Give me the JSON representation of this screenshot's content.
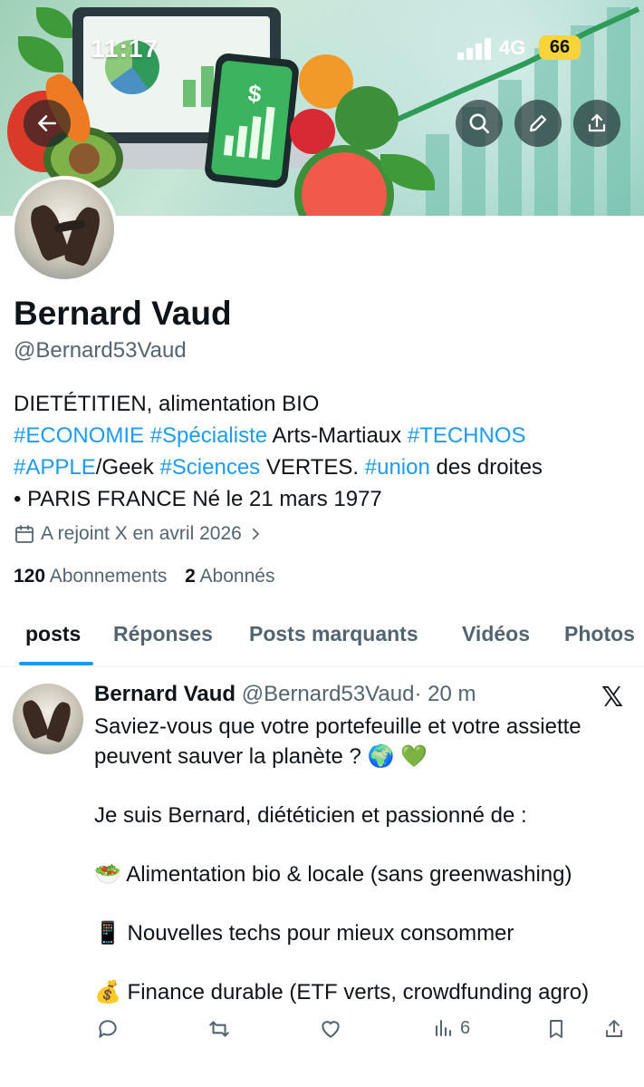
{
  "status_bar": {
    "time": "11:17",
    "network": "4G",
    "battery": "66"
  },
  "profile": {
    "name": "Bernard Vaud",
    "handle": "@Bernard53Vaud",
    "bio": {
      "line1": "DIETÉTITIEN, alimentation BIO",
      "l2_tag1": "#ECONOMIE",
      "l2_tag2": "#Spécialiste",
      "l2_text": " Arts-Martiaux ",
      "l2_tag3": "#TECHNOS",
      "l3_tag1": "#APPLE",
      "l3_text1": "/Geek ",
      "l3_tag2": "#Sciences",
      "l3_text2": " VERTES. ",
      "l3_tag3": "#union",
      "l3_text3": " des droites",
      "line4": "• PARIS FRANCE Né le 21 mars 1977"
    },
    "joined": "A rejoint X en avril 2026",
    "following_count": "120",
    "following_label": "Abonnements",
    "followers_count": "2",
    "followers_label": "Abonnés"
  },
  "tabs": [
    "posts",
    "Réponses",
    "Posts marquants",
    "Vidéos",
    "Photos"
  ],
  "post": {
    "author": "Bernard Vaud",
    "handle": "@Bernard53Vaud",
    "time": "· 20 m",
    "text": "Saviez-vous que votre portefeuille et votre assiette peuvent sauver la planète ? 🌍 💚\n\nJe suis Bernard, diététicien et passionné de :\n\n🥗 Alimentation bio & locale (sans greenwashing)\n\n📱 Nouvelles techs pour mieux consommer\n\n💰 Finance durable (ETF verts, crowdfunding agro)",
    "views": "6"
  },
  "colors": {
    "accent": "#1d9bf0",
    "text": "#0f1419",
    "muted": "#536471"
  }
}
